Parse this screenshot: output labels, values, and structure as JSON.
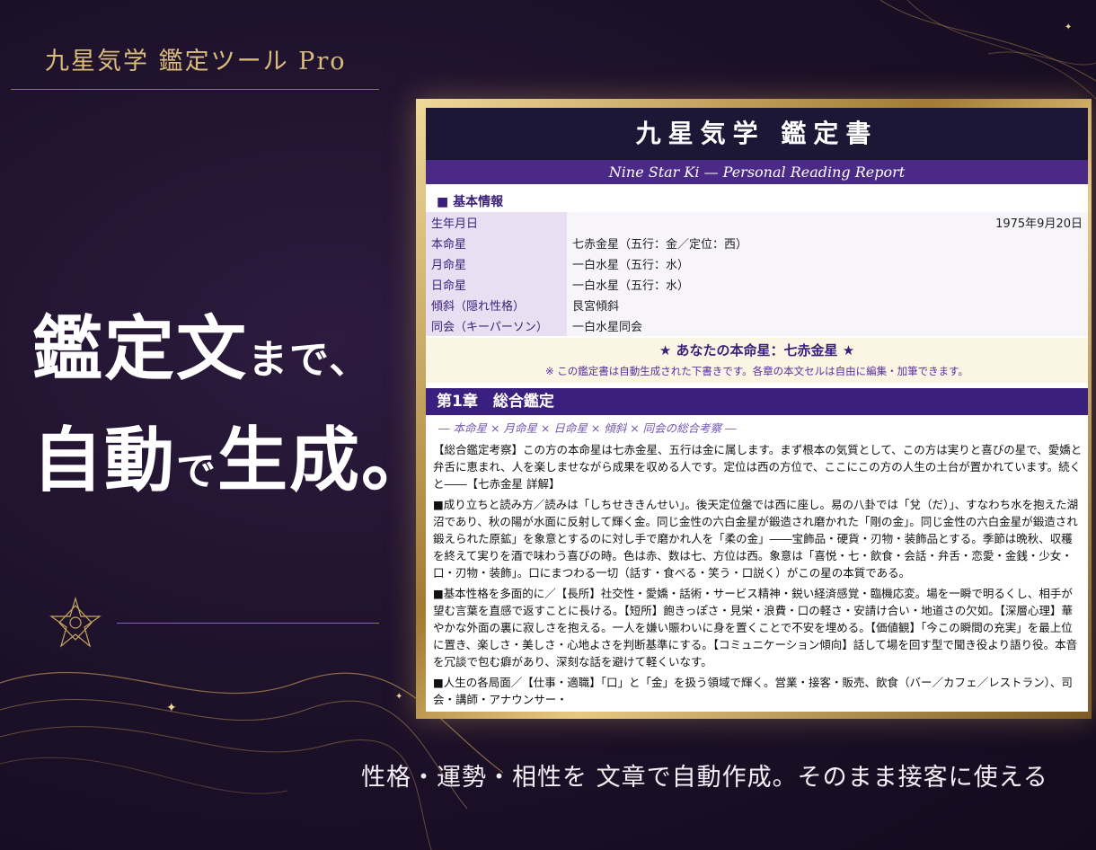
{
  "brand": {
    "title": "九星気学 鑑定ツール Pro"
  },
  "headline": {
    "line1_big": "鑑定文",
    "line1_small": "まで、",
    "line2_big1": "自動",
    "line2_small": "で",
    "line2_big2": "生成。"
  },
  "tagline": "性格・運勢・相性を 文章で自動作成。そのまま接客に使える",
  "document": {
    "title": "九星気学 鑑定書",
    "subtitle": "Nine Star Ki — Personal Reading Report",
    "basic_info_label": "■ 基本情報",
    "rows": [
      {
        "key": "生年月日",
        "value": "1975年9月20日"
      },
      {
        "key": "本命星",
        "value": "七赤金星（五行：金／定位：西）"
      },
      {
        "key": "月命星",
        "value": "一白水星（五行：水）"
      },
      {
        "key": "日命星",
        "value": "一白水星（五行：水）"
      },
      {
        "key": "傾斜（隠れ性格）",
        "value": "艮宮傾斜"
      },
      {
        "key": "同会（キーパーソン）",
        "value": "一白水星同会"
      }
    ],
    "my_star": "★ あなたの本命星：七赤金星 ★",
    "note": "※ この鑑定書は自動生成された下書きです。各章の本文セルは自由に編集・加筆できます。",
    "chapter_title": "第1章　総合鑑定",
    "chapter_sub": "― 本命星 × 月命星 × 日命星 × 傾斜 × 同会の総合考察 ―",
    "paragraphs": [
      "【総合鑑定考察】この方の本命星は七赤金星、五行は金に属します。まず根本の気質として、この方は実りと喜びの星で、愛嬌と弁舌に恵まれ、人を楽しませながら成果を収める人です。定位は西の方位で、ここにこの方の人生の土台が置かれています。続くと――【七赤金星 詳解】",
      "■成り立ちと読み方／読みは「しちせききんせい」。後天定位盤では西に座し。易の八卦では「兌（だ）」、すなわち水を抱えた湖沼であり、秋の陽が水面に反射して輝く金。同じ金性の六白金星が鍛造され磨かれた「剛の金」。同じ金性の六白金星が鍛造され鍛えられた原鉱」を象意とするのに対し手で磨かれ人を「柔の金」――宝飾品・硬貨・刃物・装飾品とする。季節は晩秋、収穫を終えて実りを酒で味わう喜びの時。色は赤、数は七、方位は西。象意は「喜悦・七・飲食・会話・弁舌・恋愛・金銭・少女・口・刃物・装飾」。口にまつわる一切（話す・食べる・笑う・口説く）がこの星の本質である。",
      "■基本性格を多面的に／【長所】社交性・愛嬌・話術・サービス精神・鋭い経済感覚・臨機応変。場を一瞬で明るくし、相手が望む言葉を直感で返すことに長ける。【短所】飽きっぽさ・見栄・浪費・口の軽さ・安請け合い・地道さの欠如。【深層心理】華やかな外面の裏に寂しさを抱える。一人を嫌い賑わいに身を置くことで不安を埋める。【価値観】「今この瞬間の充実」を最上位に置き、楽しさ・美しさ・心地よさを判断基準にする。【コミュニケーション傾向】話して場を回す型で聞き役より語り役。本音を冗談で包む癖があり、深刻な話を避けて軽くいなす。",
      "■人生の各局面／【仕事・適職】「口」と「金」を扱う領域で輝く。営業・接客・販売、飲食（バー／カフェ／レストラン）、司会・講師・アナウンサー・"
    ]
  },
  "colors": {
    "gold": "#d9bb7a",
    "navy": "#1b1735",
    "purple": "#3b1f7e",
    "background": "#1c1028"
  }
}
